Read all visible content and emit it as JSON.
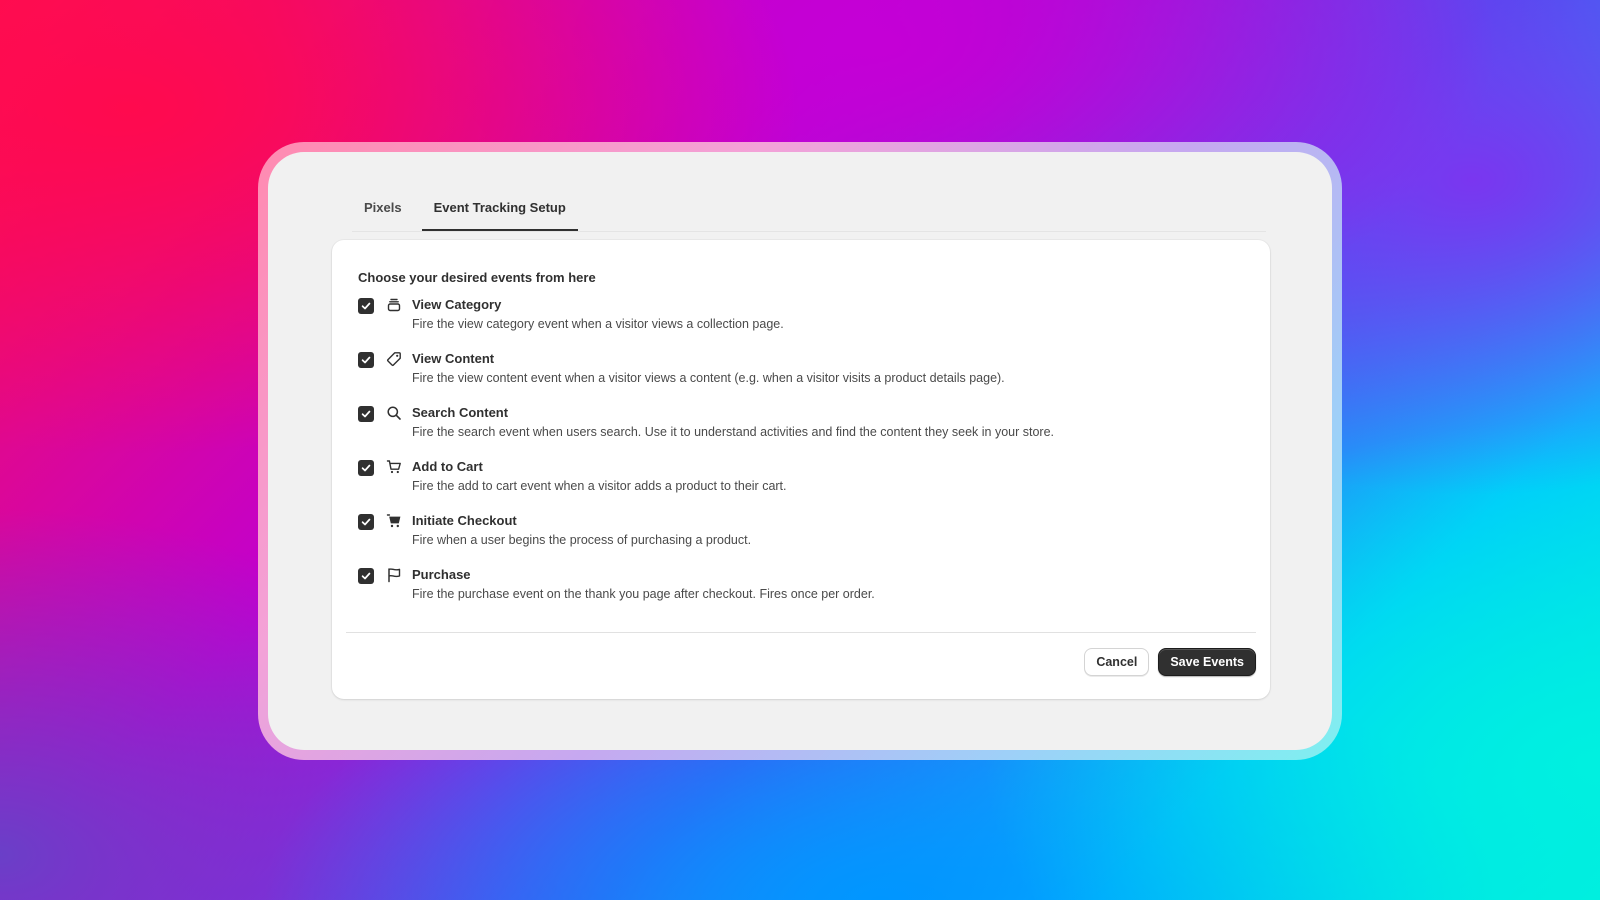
{
  "tabs": [
    {
      "label": "Pixels",
      "active": false
    },
    {
      "label": "Event Tracking Setup",
      "active": true
    }
  ],
  "card": {
    "heading": "Choose your desired events from here",
    "events": [
      {
        "title": "View Category",
        "description": "Fire the view category event when a visitor views a collection page.",
        "icon": "collection-stack-icon",
        "checked": true
      },
      {
        "title": "View Content",
        "description": "Fire the view content event when a visitor views a content (e.g. when a visitor visits a product details page).",
        "icon": "tag-icon",
        "checked": true
      },
      {
        "title": "Search Content",
        "description": "Fire the search event when users search. Use it to understand activities and find the content they seek in your store.",
        "icon": "search-icon",
        "checked": true
      },
      {
        "title": "Add to Cart",
        "description": "Fire the add to cart event when a visitor adds a product to their cart.",
        "icon": "cart-outline-icon",
        "checked": true
      },
      {
        "title": "Initiate Checkout",
        "description": "Fire when a user begins the process of purchasing a product.",
        "icon": "cart-filled-icon",
        "checked": true
      },
      {
        "title": "Purchase",
        "description": "Fire the purchase event on the thank you page after checkout. Fires once per order.",
        "icon": "flag-icon",
        "checked": true
      }
    ]
  },
  "actions": {
    "cancel_label": "Cancel",
    "save_label": "Save Events"
  },
  "colors": {
    "primary_button": "#303030",
    "checkbox_checked": "#303030",
    "window_bg": "#f1f1f1",
    "card_bg": "#ffffff"
  }
}
